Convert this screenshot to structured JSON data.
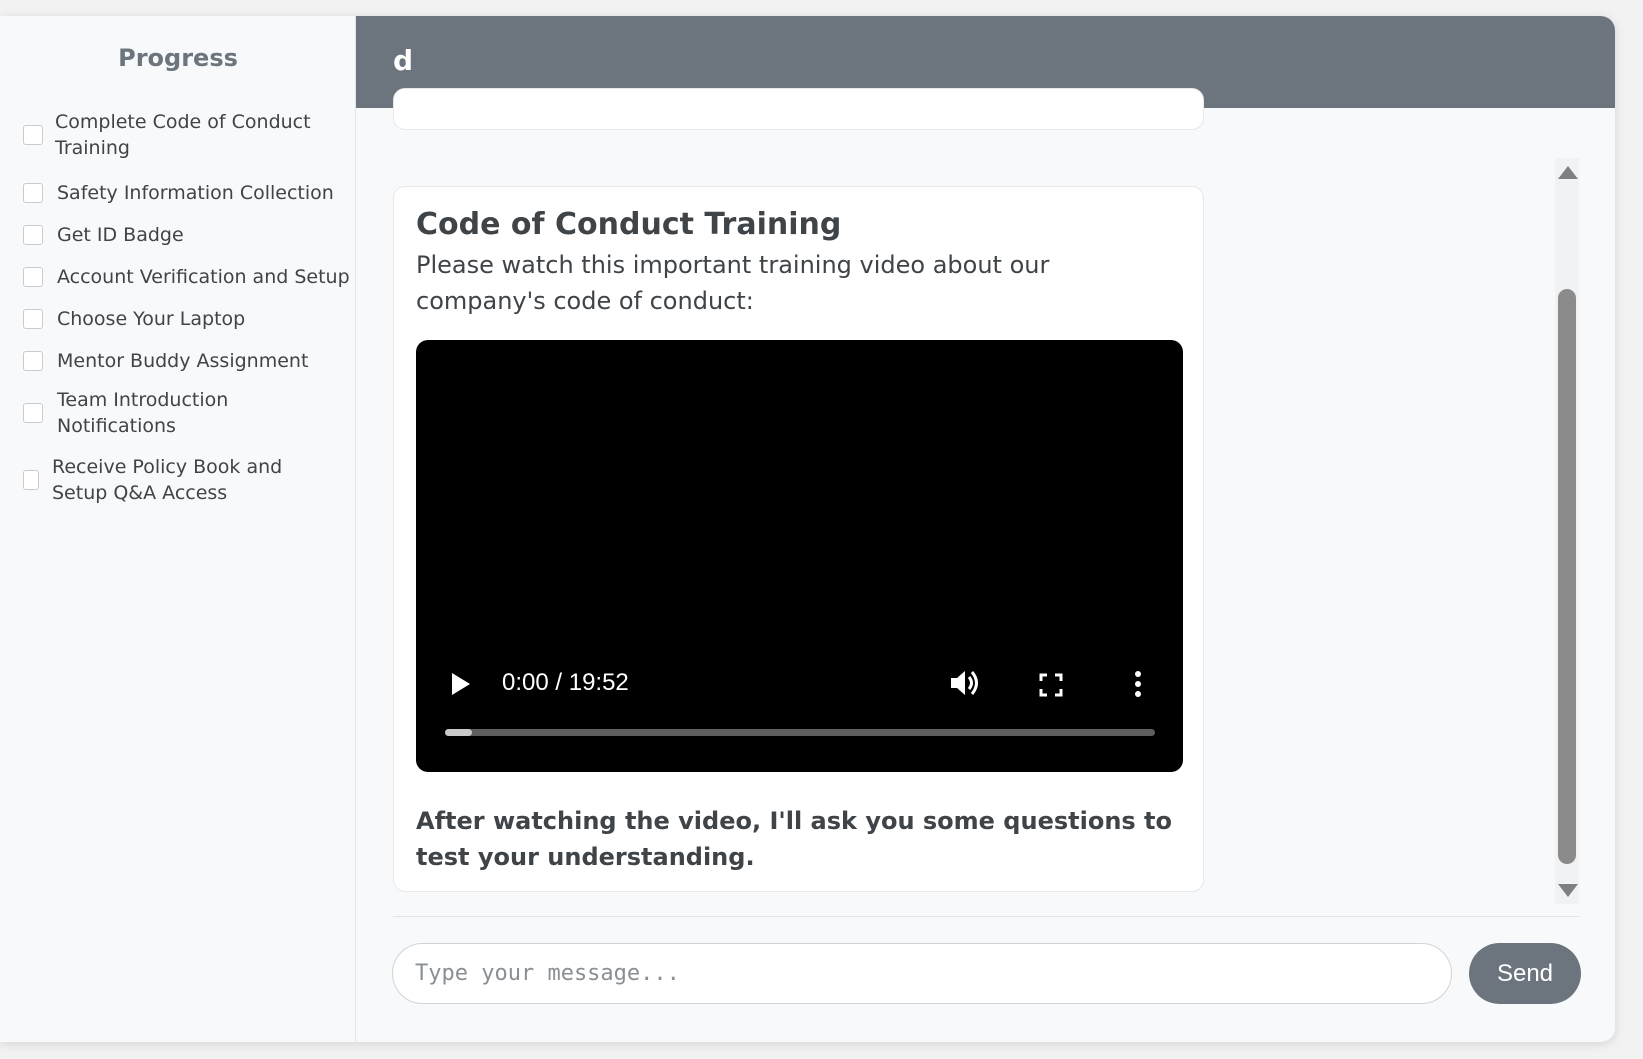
{
  "sidebar": {
    "title": "Progress",
    "items": [
      {
        "label": "Complete Code of Conduct Training",
        "checked": false
      },
      {
        "label": "Safety Information Collection",
        "checked": false
      },
      {
        "label": "Get ID Badge",
        "checked": false
      },
      {
        "label": "Account Verification and Setup",
        "checked": false
      },
      {
        "label": "Choose Your Laptop",
        "checked": false
      },
      {
        "label": "Mentor Buddy Assignment",
        "checked": false
      },
      {
        "label": "Team Introduction Notifications",
        "checked": false
      },
      {
        "label": "Receive Policy Book and Setup Q&A Access",
        "checked": false
      }
    ]
  },
  "header": {
    "title": "d",
    "color": "#6c757d"
  },
  "message": {
    "title": "Code of Conduct Training",
    "description": "Please watch this important training video about our company's code of conduct:",
    "video": {
      "time": "0:00 / 19:52",
      "progress": 0.0,
      "controls": [
        "play-icon",
        "volume-icon",
        "fullscreen-icon",
        "more-options-icon"
      ]
    },
    "note": "After watching the video, I'll ask you some questions to test your understanding."
  },
  "composer": {
    "placeholder": "Type your message...",
    "value": "",
    "send_label": "Send",
    "send_color": "#6c757d"
  }
}
